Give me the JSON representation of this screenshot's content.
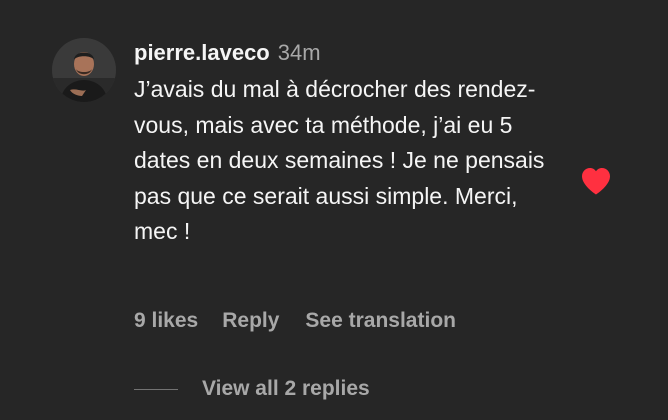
{
  "comment": {
    "username": "pierre.laveco",
    "time": "34m",
    "text": "J’avais du mal à décrocher des rendez-vous, mais avec ta méthode, j’ai eu 5 dates en deux semaines ! Je ne pensais pas que ce serait aussi simple. Merci, mec !",
    "likes_label": "9 likes",
    "reply_label": "Reply",
    "translate_label": "See translation",
    "liked": true,
    "heart_icon": "heart-filled-icon",
    "heart_color": "#ff3040"
  },
  "replies": {
    "label": "View all 2 replies"
  },
  "colors": {
    "background": "#262626",
    "primary_text": "#f5f5f5",
    "secondary_text": "#a8a8a8"
  }
}
